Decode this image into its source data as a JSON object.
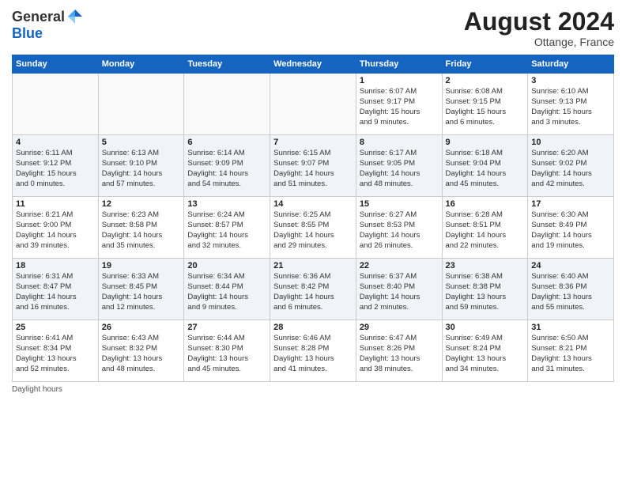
{
  "header": {
    "logo_general": "General",
    "logo_blue": "Blue",
    "month_year": "August 2024",
    "location": "Ottange, France"
  },
  "footer": {
    "label": "Daylight hours"
  },
  "days_of_week": [
    "Sunday",
    "Monday",
    "Tuesday",
    "Wednesday",
    "Thursday",
    "Friday",
    "Saturday"
  ],
  "weeks": [
    [
      {
        "day": "",
        "info": ""
      },
      {
        "day": "",
        "info": ""
      },
      {
        "day": "",
        "info": ""
      },
      {
        "day": "",
        "info": ""
      },
      {
        "day": "1",
        "info": "Sunrise: 6:07 AM\nSunset: 9:17 PM\nDaylight: 15 hours\nand 9 minutes."
      },
      {
        "day": "2",
        "info": "Sunrise: 6:08 AM\nSunset: 9:15 PM\nDaylight: 15 hours\nand 6 minutes."
      },
      {
        "day": "3",
        "info": "Sunrise: 6:10 AM\nSunset: 9:13 PM\nDaylight: 15 hours\nand 3 minutes."
      }
    ],
    [
      {
        "day": "4",
        "info": "Sunrise: 6:11 AM\nSunset: 9:12 PM\nDaylight: 15 hours\nand 0 minutes."
      },
      {
        "day": "5",
        "info": "Sunrise: 6:13 AM\nSunset: 9:10 PM\nDaylight: 14 hours\nand 57 minutes."
      },
      {
        "day": "6",
        "info": "Sunrise: 6:14 AM\nSunset: 9:09 PM\nDaylight: 14 hours\nand 54 minutes."
      },
      {
        "day": "7",
        "info": "Sunrise: 6:15 AM\nSunset: 9:07 PM\nDaylight: 14 hours\nand 51 minutes."
      },
      {
        "day": "8",
        "info": "Sunrise: 6:17 AM\nSunset: 9:05 PM\nDaylight: 14 hours\nand 48 minutes."
      },
      {
        "day": "9",
        "info": "Sunrise: 6:18 AM\nSunset: 9:04 PM\nDaylight: 14 hours\nand 45 minutes."
      },
      {
        "day": "10",
        "info": "Sunrise: 6:20 AM\nSunset: 9:02 PM\nDaylight: 14 hours\nand 42 minutes."
      }
    ],
    [
      {
        "day": "11",
        "info": "Sunrise: 6:21 AM\nSunset: 9:00 PM\nDaylight: 14 hours\nand 39 minutes."
      },
      {
        "day": "12",
        "info": "Sunrise: 6:23 AM\nSunset: 8:58 PM\nDaylight: 14 hours\nand 35 minutes."
      },
      {
        "day": "13",
        "info": "Sunrise: 6:24 AM\nSunset: 8:57 PM\nDaylight: 14 hours\nand 32 minutes."
      },
      {
        "day": "14",
        "info": "Sunrise: 6:25 AM\nSunset: 8:55 PM\nDaylight: 14 hours\nand 29 minutes."
      },
      {
        "day": "15",
        "info": "Sunrise: 6:27 AM\nSunset: 8:53 PM\nDaylight: 14 hours\nand 26 minutes."
      },
      {
        "day": "16",
        "info": "Sunrise: 6:28 AM\nSunset: 8:51 PM\nDaylight: 14 hours\nand 22 minutes."
      },
      {
        "day": "17",
        "info": "Sunrise: 6:30 AM\nSunset: 8:49 PM\nDaylight: 14 hours\nand 19 minutes."
      }
    ],
    [
      {
        "day": "18",
        "info": "Sunrise: 6:31 AM\nSunset: 8:47 PM\nDaylight: 14 hours\nand 16 minutes."
      },
      {
        "day": "19",
        "info": "Sunrise: 6:33 AM\nSunset: 8:45 PM\nDaylight: 14 hours\nand 12 minutes."
      },
      {
        "day": "20",
        "info": "Sunrise: 6:34 AM\nSunset: 8:44 PM\nDaylight: 14 hours\nand 9 minutes."
      },
      {
        "day": "21",
        "info": "Sunrise: 6:36 AM\nSunset: 8:42 PM\nDaylight: 14 hours\nand 6 minutes."
      },
      {
        "day": "22",
        "info": "Sunrise: 6:37 AM\nSunset: 8:40 PM\nDaylight: 14 hours\nand 2 minutes."
      },
      {
        "day": "23",
        "info": "Sunrise: 6:38 AM\nSunset: 8:38 PM\nDaylight: 13 hours\nand 59 minutes."
      },
      {
        "day": "24",
        "info": "Sunrise: 6:40 AM\nSunset: 8:36 PM\nDaylight: 13 hours\nand 55 minutes."
      }
    ],
    [
      {
        "day": "25",
        "info": "Sunrise: 6:41 AM\nSunset: 8:34 PM\nDaylight: 13 hours\nand 52 minutes."
      },
      {
        "day": "26",
        "info": "Sunrise: 6:43 AM\nSunset: 8:32 PM\nDaylight: 13 hours\nand 48 minutes."
      },
      {
        "day": "27",
        "info": "Sunrise: 6:44 AM\nSunset: 8:30 PM\nDaylight: 13 hours\nand 45 minutes."
      },
      {
        "day": "28",
        "info": "Sunrise: 6:46 AM\nSunset: 8:28 PM\nDaylight: 13 hours\nand 41 minutes."
      },
      {
        "day": "29",
        "info": "Sunrise: 6:47 AM\nSunset: 8:26 PM\nDaylight: 13 hours\nand 38 minutes."
      },
      {
        "day": "30",
        "info": "Sunrise: 6:49 AM\nSunset: 8:24 PM\nDaylight: 13 hours\nand 34 minutes."
      },
      {
        "day": "31",
        "info": "Sunrise: 6:50 AM\nSunset: 8:21 PM\nDaylight: 13 hours\nand 31 minutes."
      }
    ]
  ]
}
